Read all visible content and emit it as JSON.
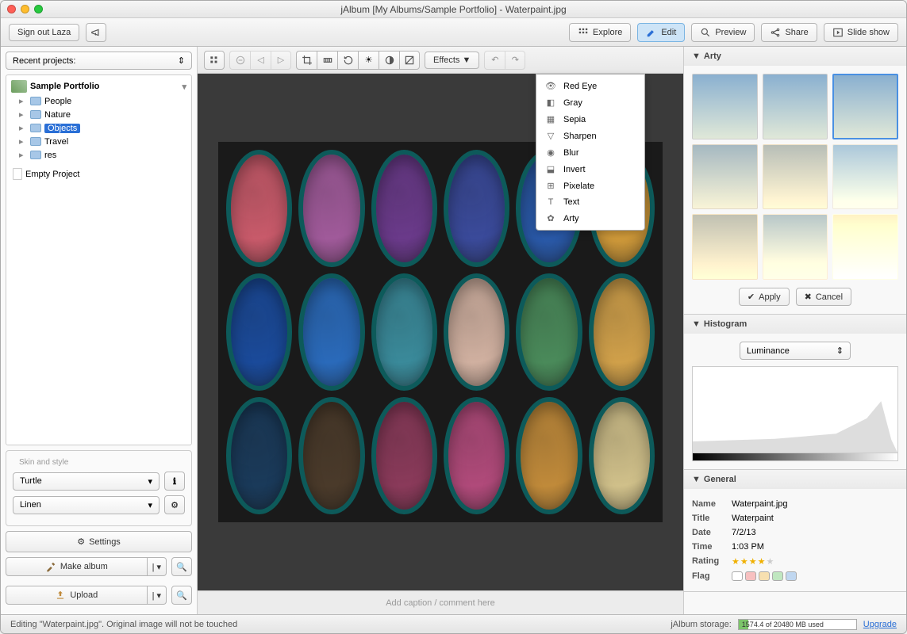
{
  "title": "jAlbum [My Albums/Sample Portfolio] - Waterpaint.jpg",
  "toolbar": {
    "signout": "Sign out Laza",
    "explore": "Explore",
    "edit": "Edit",
    "preview": "Preview",
    "share": "Share",
    "slideshow": "Slide show"
  },
  "sidebar": {
    "recent": "Recent projects:",
    "album": "Sample Portfolio",
    "tree": [
      "People",
      "Nature",
      "Objects",
      "Travel",
      "res"
    ],
    "selected": "Objects",
    "empty": "Empty Project",
    "skin_style": "Skin and style",
    "skin": "Turtle",
    "style": "Linen",
    "settings": "Settings",
    "make_album": "Make album",
    "upload": "Upload"
  },
  "effects": {
    "button": "Effects ▼",
    "items": [
      "Red Eye",
      "Gray",
      "Sepia",
      "Sharpen",
      "Blur",
      "Invert",
      "Pixelate",
      "Text",
      "Arty"
    ]
  },
  "caption_placeholder": "Add caption / comment here",
  "right": {
    "arty": "Arty",
    "apply": "Apply",
    "cancel": "Cancel",
    "histogram": "Histogram",
    "luminance": "Luminance",
    "general": "General",
    "props": {
      "name_k": "Name",
      "name_v": "Waterpaint.jpg",
      "title_k": "Title",
      "title_v": "Waterpaint",
      "date_k": "Date",
      "date_v": "7/2/13",
      "time_k": "Time",
      "time_v": "1:03 PM",
      "rating_k": "Rating",
      "flag_k": "Flag"
    },
    "rating": 4
  },
  "status": {
    "msg": "Editing \"Waterpaint.jpg\". Original image will not be touched",
    "storage_label": "jAlbum storage:",
    "storage_text": "1574.4 of 20480 MB used",
    "upgrade": "Upgrade"
  },
  "paint_colors": [
    "#c85a6a",
    "#a05a9a",
    "#6a3a8a",
    "#3a4a9a",
    "#2a5aaa",
    "#d09a3a",
    "#1a4a9a",
    "#2a6aba",
    "#3a8a9a",
    "#d0b0a0",
    "#4a8a5a",
    "#d0a04a",
    "#1a3a5a",
    "#4a3a2a",
    "#8a3a5a",
    "#b04a7a",
    "#c08a3a",
    "#d0c08a"
  ],
  "flag_colors": [
    "#fff",
    "#f7c0c0",
    "#f7e0b0",
    "#c0e7c0",
    "#c0d7f0"
  ]
}
